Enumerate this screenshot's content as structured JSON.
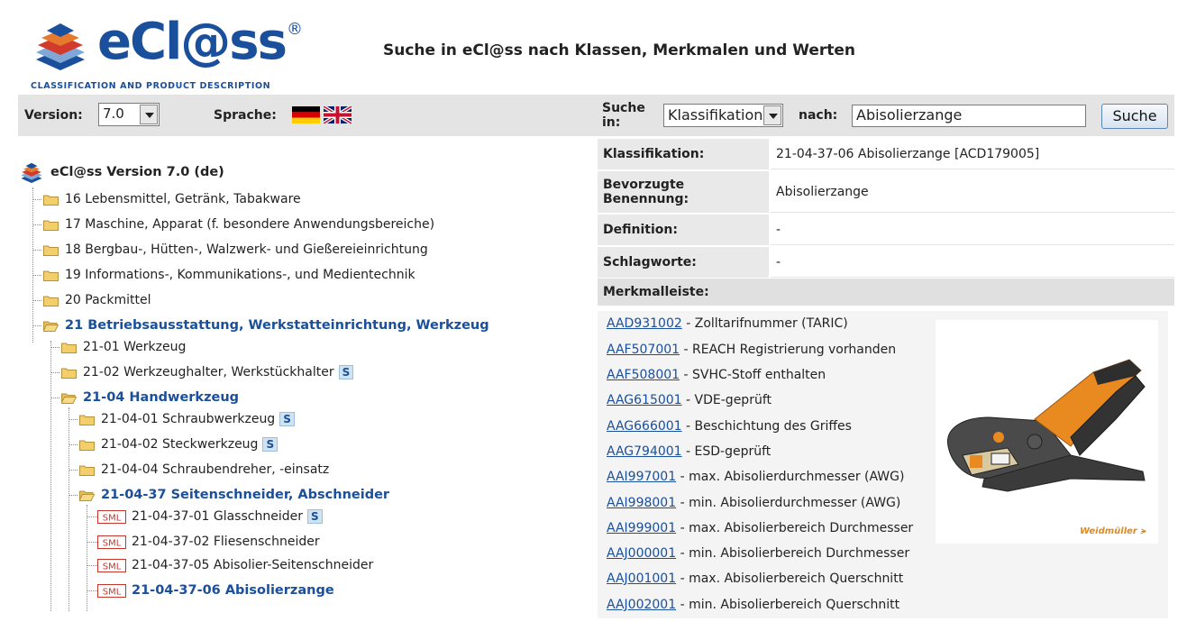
{
  "header": {
    "logo_text": "eCl@ss",
    "logo_reg": "®",
    "logo_tagline": "CLASSIFICATION AND PRODUCT DESCRIPTION",
    "title": "Suche in eCl@ss nach Klassen, Merkmalen und Werten"
  },
  "toolbar": {
    "version_label": "Version:",
    "version_value": "7.0",
    "language_label": "Sprache:",
    "flags": [
      "german-flag-icon",
      "uk-flag-icon"
    ],
    "search_in_label_1": "Suche",
    "search_in_label_2": "in:",
    "search_in_value": "Klassifikation",
    "search_for_label": "nach:",
    "search_value": "Abisolierzange",
    "search_button": "Suche"
  },
  "tree": {
    "root": "eCl@ss Version 7.0 (de)",
    "items": [
      {
        "label": "16 Lebensmittel, Getränk, Tabakware",
        "open": false
      },
      {
        "label": "17 Maschine, Apparat (f. besondere Anwendungsbereiche)",
        "open": false
      },
      {
        "label": "18 Bergbau-, Hütten-, Walzwerk- und Gießereieinrichtung",
        "open": false
      },
      {
        "label": "19 Informations-, Kommunikations-, und Medientechnik",
        "open": false
      },
      {
        "label": "20 Packmittel",
        "open": false
      },
      {
        "label": "21 Betriebsausstattung, Werkstatteinrichtung, Werkzeug",
        "open": true
      },
      {
        "label": "21-01 Werkzeug",
        "open": false
      },
      {
        "label": "21-02 Werkzeughalter, Werkstückhalter",
        "open": false,
        "badge": "S"
      },
      {
        "label": "21-04 Handwerkzeug",
        "open": true
      },
      {
        "label": "21-04-01 Schraubwerkzeug",
        "open": false,
        "badge": "S"
      },
      {
        "label": "21-04-02 Steckwerkzeug",
        "open": false,
        "badge": "S"
      },
      {
        "label": "21-04-04 Schraubendreher, -einsatz",
        "open": false
      },
      {
        "label": "21-04-37 Seitenschneider, Abschneider",
        "open": true
      },
      {
        "label": "21-04-37-01 Glasschneider",
        "badge": "S",
        "sml": "SML"
      },
      {
        "label": "21-04-37-02 Fliesenschneider",
        "sml": "SML"
      },
      {
        "label": "21-04-37-05 Abisolier-Seitenschneider",
        "sml": "SML"
      },
      {
        "label": "21-04-37-06 Abisolierzange",
        "sml": "SML",
        "selected": true
      }
    ]
  },
  "details": {
    "classification_label": "Klassifikation:",
    "classification_value": "21-04-37-06 Abisolierzange [ACD179005]",
    "preferred_label_1": "Bevorzugte",
    "preferred_label_2": "Benennung:",
    "preferred_value": "Abisolierzange",
    "definition_label": "Definition:",
    "definition_value": "-",
    "keywords_label": "Schlagworte:",
    "keywords_value": "-",
    "merkmal_header": "Merkmalleiste:",
    "brand": "Weidmüller"
  },
  "merkmale": [
    {
      "code": "AAD931002",
      "text": " - Zolltarifnummer (TARIC)"
    },
    {
      "code": "AAF507001",
      "text": " - REACH Registrierung vorhanden"
    },
    {
      "code": "AAF508001",
      "text": " - SVHC-Stoff enthalten"
    },
    {
      "code": "AAG615001",
      "text": " - VDE-geprüft"
    },
    {
      "code": "AAG666001",
      "text": " - Beschichtung des Griffes"
    },
    {
      "code": "AAG794001",
      "text": " - ESD-geprüft"
    },
    {
      "code": "AAI997001",
      "text": " - max. Abisolierdurchmesser (AWG)"
    },
    {
      "code": "AAI998001",
      "text": " - min. Abisolierdurchmesser (AWG)"
    },
    {
      "code": "AAI999001",
      "text": " - max. Abisolierbereich Durchmesser"
    },
    {
      "code": "AAJ000001",
      "text": " - min. Abisolierbereich Durchmesser"
    },
    {
      "code": "AAJ001001",
      "text": " - max. Abisolierbereich Querschnitt"
    },
    {
      "code": "AAJ002001",
      "text": " - min. Abisolierbereich Querschnitt"
    }
  ],
  "colors": {
    "brand_blue": "#1a4f9c",
    "folder_yellow": "#f2cf6b",
    "panel_gray": "#e4e4e4",
    "accent_orange": "#e08a1e"
  }
}
